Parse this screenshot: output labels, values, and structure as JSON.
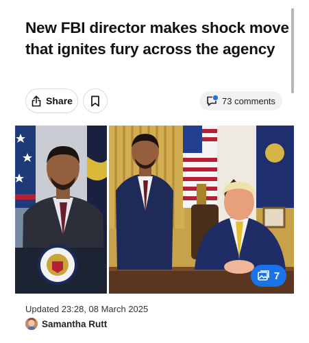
{
  "article": {
    "headline": "New FBI director makes shock move that ignites fury across the agency",
    "updated": "Updated 23:28, 08 March 2025",
    "author": "Samantha Rutt"
  },
  "actions": {
    "share_label": "Share",
    "comments_label": "73 comments"
  },
  "gallery": {
    "photo_count": "7"
  },
  "colors": {
    "accent": "#1a73e8",
    "comment_dot": "#1a73e8"
  }
}
